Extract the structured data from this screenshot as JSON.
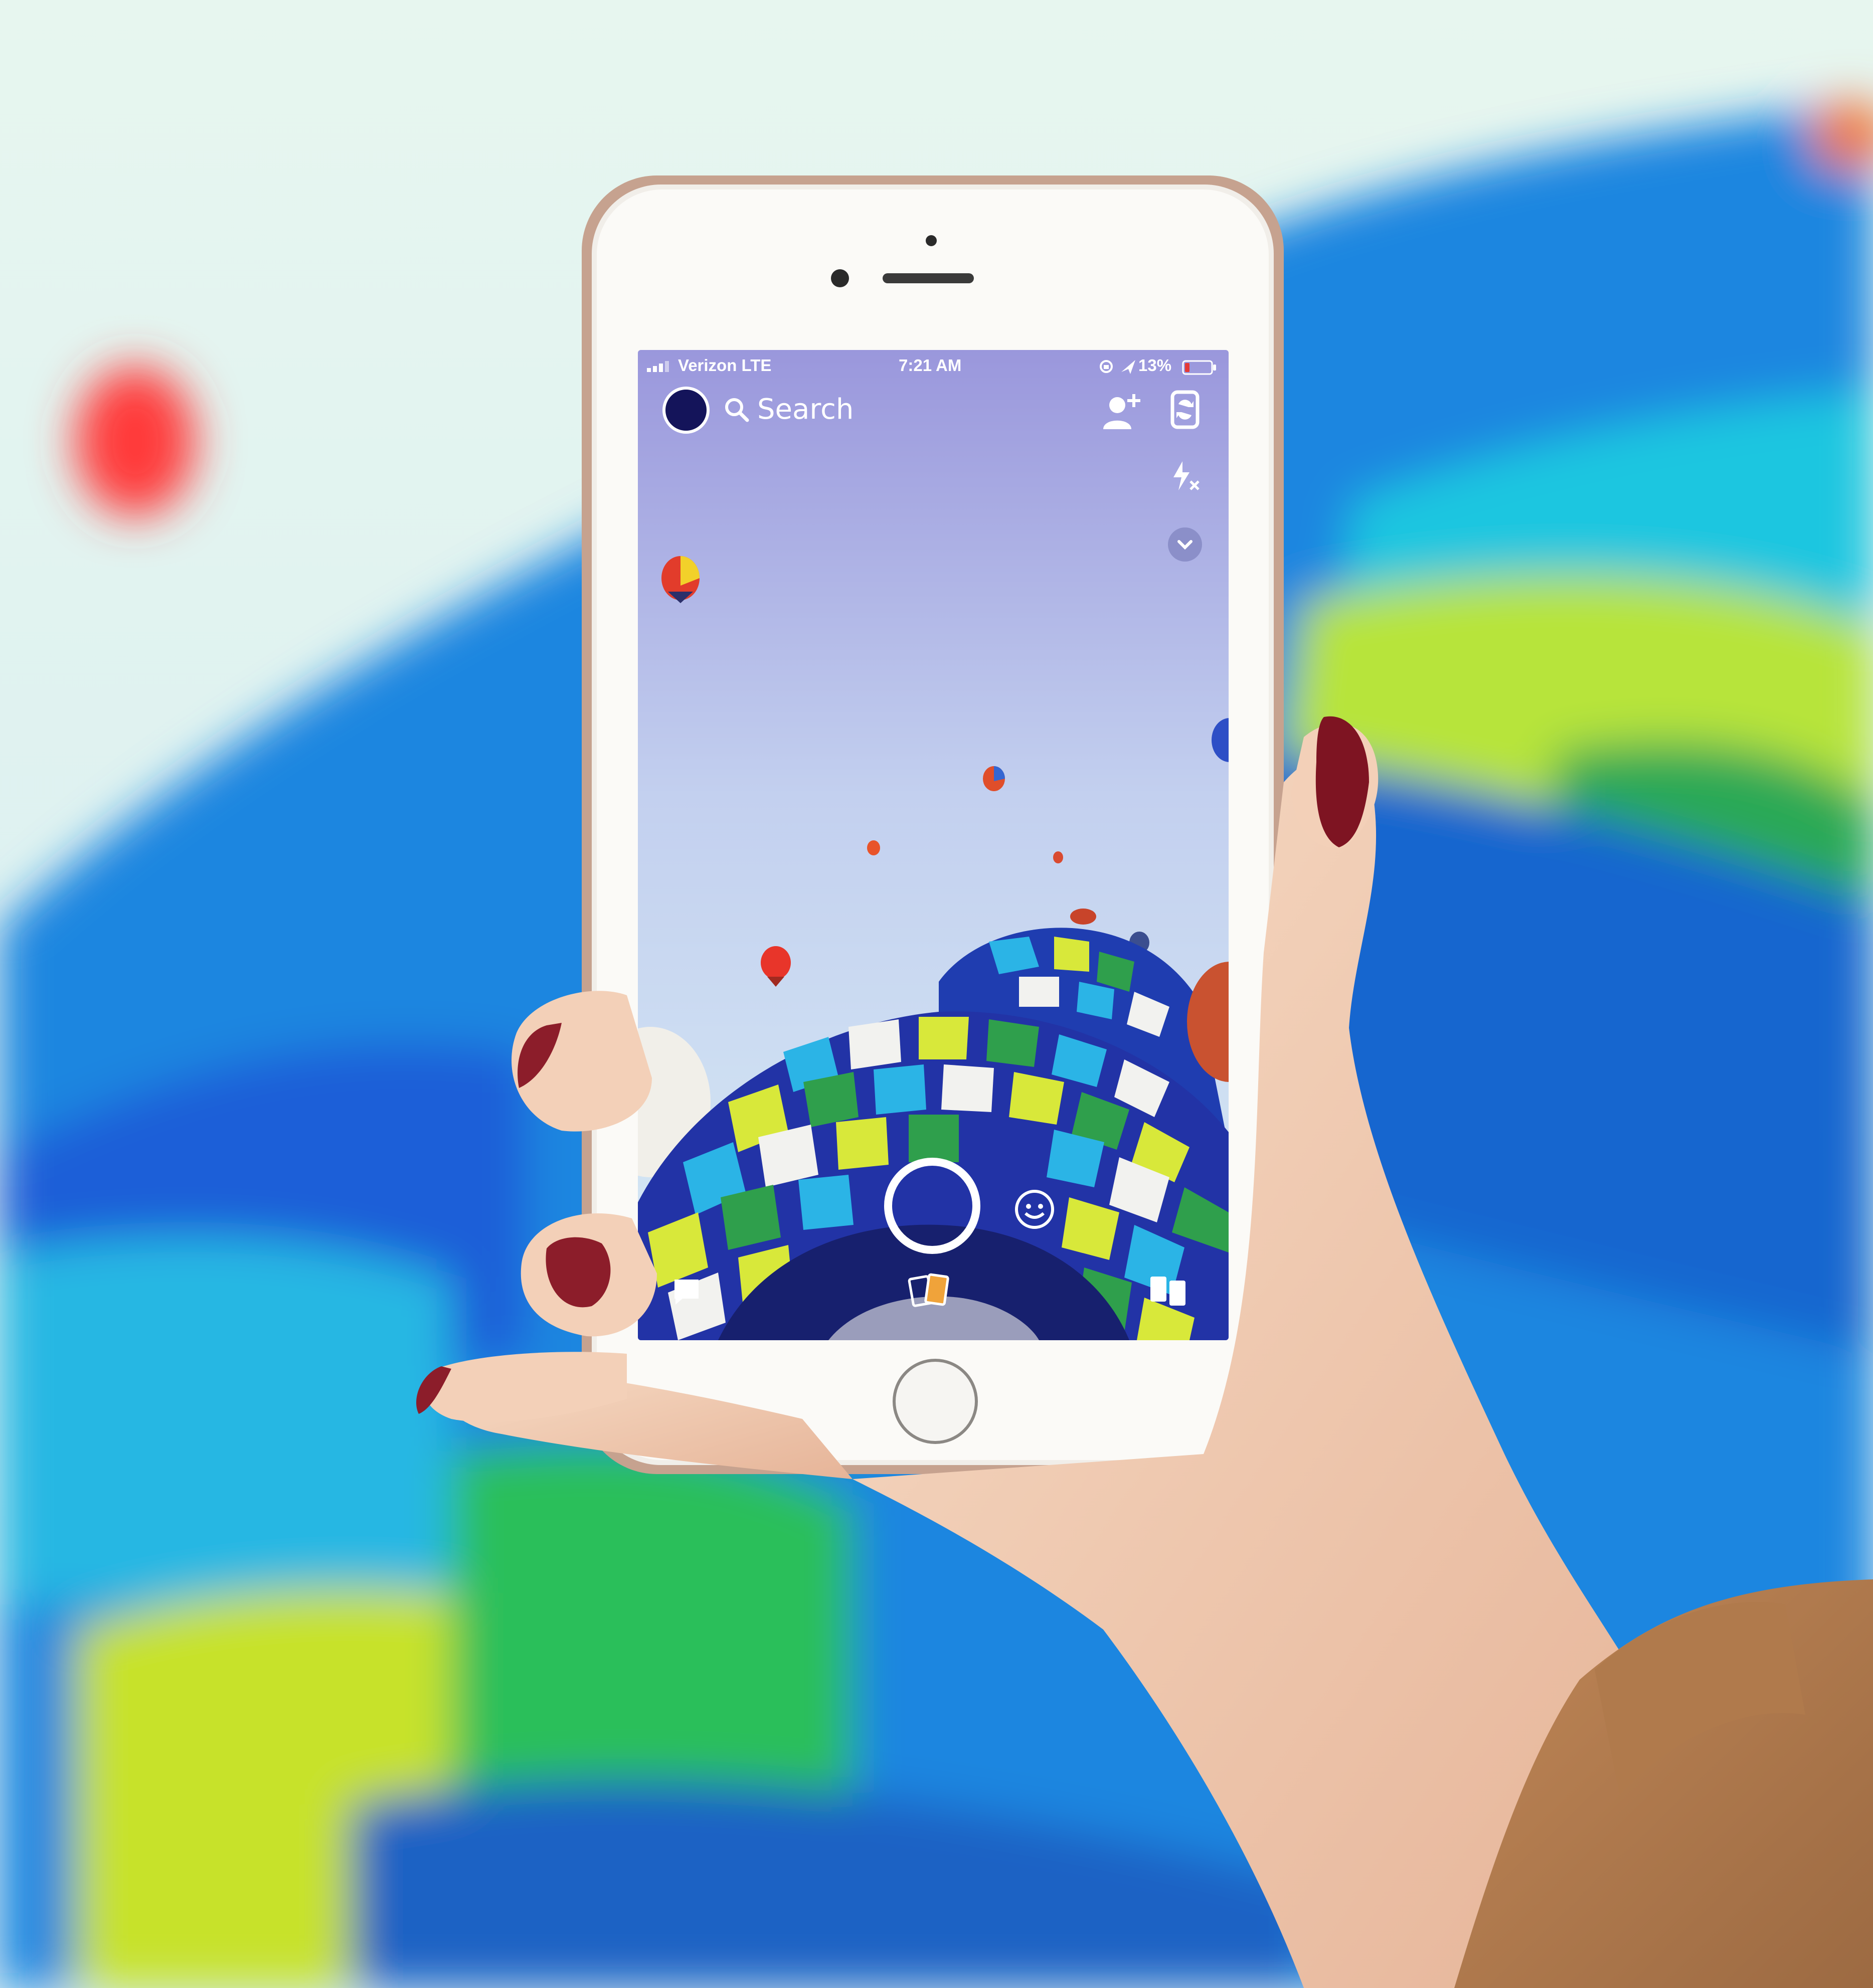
{
  "status_bar": {
    "carrier": "Verizon LTE",
    "time": "7:21 AM",
    "battery": "13%"
  },
  "camera_header": {
    "search_label": "Search"
  },
  "icons": {
    "signal": "signal-bars-icon",
    "location": "location-arrow-icon",
    "lock": "orientation-lock-icon",
    "battery": "battery-low-icon",
    "avatar": "bitmoji-avatar-icon",
    "search": "search-icon",
    "add_friend": "add-friend-icon",
    "flip": "flip-camera-icon",
    "flash": "flash-off-icon",
    "more": "chevron-down-icon",
    "shutter": "capture-button",
    "lenses": "lens-smiley-icon",
    "chat": "chat-icon",
    "memories": "memories-icon",
    "stories": "stories-icon"
  },
  "colors": {
    "battery_low": "#e53935",
    "sky_top": "#9a97dc",
    "sky_bottom": "#cfe3f2"
  }
}
